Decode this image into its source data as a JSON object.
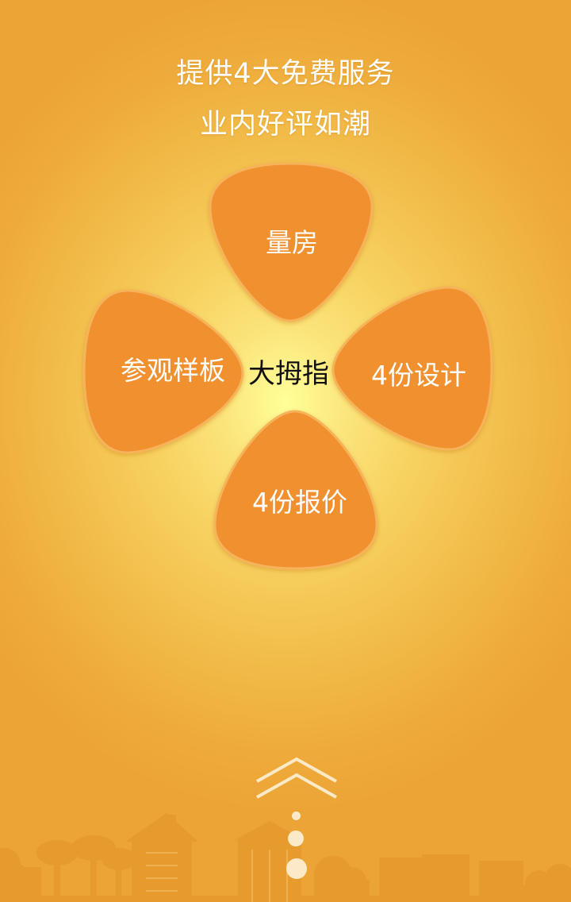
{
  "headline": {
    "line1": "提供4大免费服务",
    "line2": "业内好评如潮"
  },
  "flower": {
    "center": "大拇指",
    "petals": {
      "top": "量房",
      "left": "参观样板",
      "right": "4份设计",
      "bottom": "4份报价"
    }
  },
  "colors": {
    "petal_fill": "#f0902e",
    "petal_edge": "#f6b35a",
    "center_glow": "#ffff99",
    "background_edge": "#eca436",
    "skyline": "#e79b2c",
    "chevron": "#fbe9c8"
  },
  "icons": {
    "scroll_hint": "double-chevron-up-icon",
    "page_indicator": "dots-indicator"
  }
}
